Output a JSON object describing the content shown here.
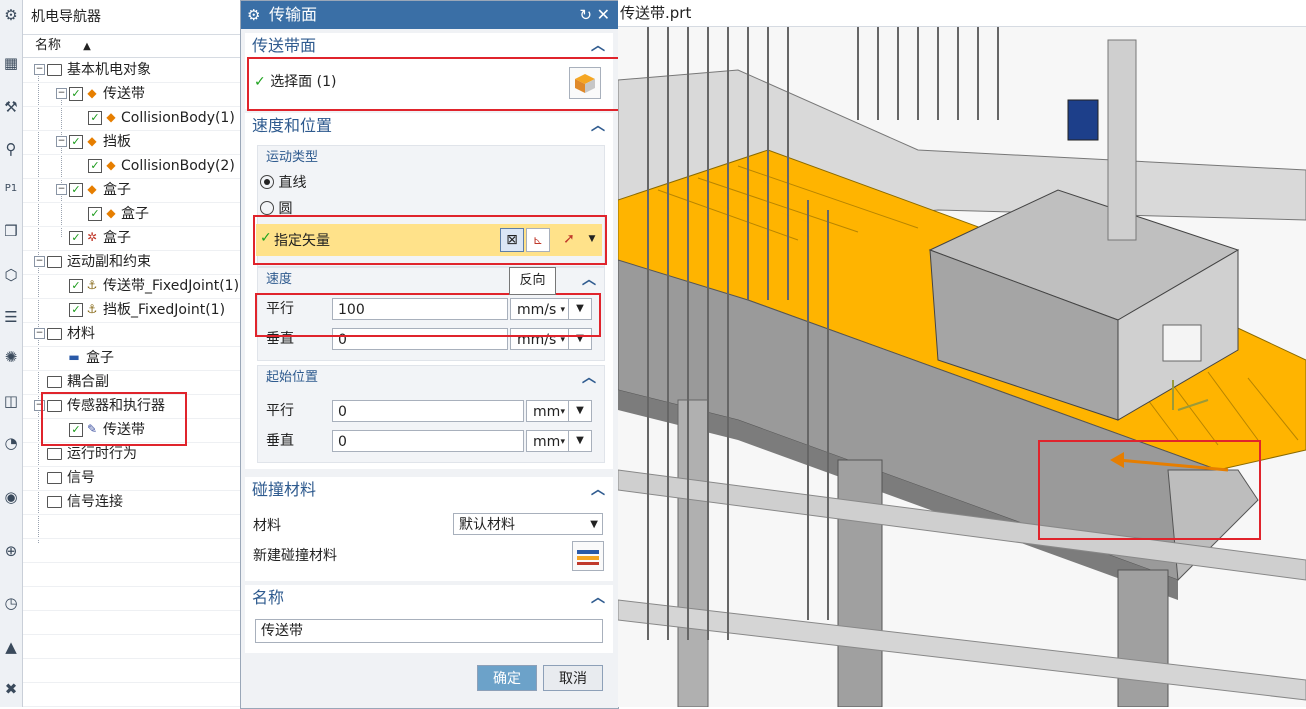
{
  "navigator": {
    "title": "机电导航器",
    "column_header": "名称",
    "rows": [
      {
        "label": "基本机电对象"
      },
      {
        "label": "传送带"
      },
      {
        "label": "CollisionBody(1)"
      },
      {
        "label": "挡板"
      },
      {
        "label": "CollisionBody(2)"
      },
      {
        "label": "盒子"
      },
      {
        "label": "盒子"
      },
      {
        "label": "盒子"
      },
      {
        "label": "运动副和约束"
      },
      {
        "label": "传送带_FixedJoint(1)"
      },
      {
        "label": "挡板_FixedJoint(1)"
      },
      {
        "label": "材料"
      },
      {
        "label": "盒子"
      },
      {
        "label": "耦合副"
      },
      {
        "label": "传感器和执行器"
      },
      {
        "label": "传送带"
      },
      {
        "label": "运行时行为"
      },
      {
        "label": "信号"
      },
      {
        "label": "信号连接"
      }
    ]
  },
  "dialog": {
    "title": "传输面",
    "conveyor_section": {
      "header": "传送带面",
      "select_face": "选择面 (1)"
    },
    "speed_position": {
      "header": "速度和位置",
      "motion_type_header": "运动类型",
      "option_line": "直线",
      "option_circle": "圆",
      "specify_vector": "指定矢量",
      "speed_header": "速度",
      "parallel_label": "平行",
      "parallel_value": "100",
      "parallel_unit": "mm/s",
      "perp_label": "垂直",
      "perp_value": "0",
      "perp_unit": "mm/s",
      "start_header": "起始位置",
      "start_parallel_label": "平行",
      "start_parallel_value": "0",
      "start_parallel_unit": "mm",
      "start_perp_label": "垂直",
      "start_perp_value": "0",
      "start_perp_unit": "mm"
    },
    "collision": {
      "header": "碰撞材料",
      "material_label": "材料",
      "material_value": "默认材料",
      "new_material_label": "新建碰撞材料"
    },
    "name_section": {
      "header": "名称",
      "value": "传送带"
    },
    "ok": "确定",
    "cancel": "取消"
  },
  "tooltip": "反向",
  "viewport": {
    "file_title": "传送带.prt"
  },
  "colors": {
    "title_bar": "#3a6fa6",
    "highlight_row": "#ffe28a",
    "belt": "#ffb400",
    "red_box": "#e0242c"
  }
}
